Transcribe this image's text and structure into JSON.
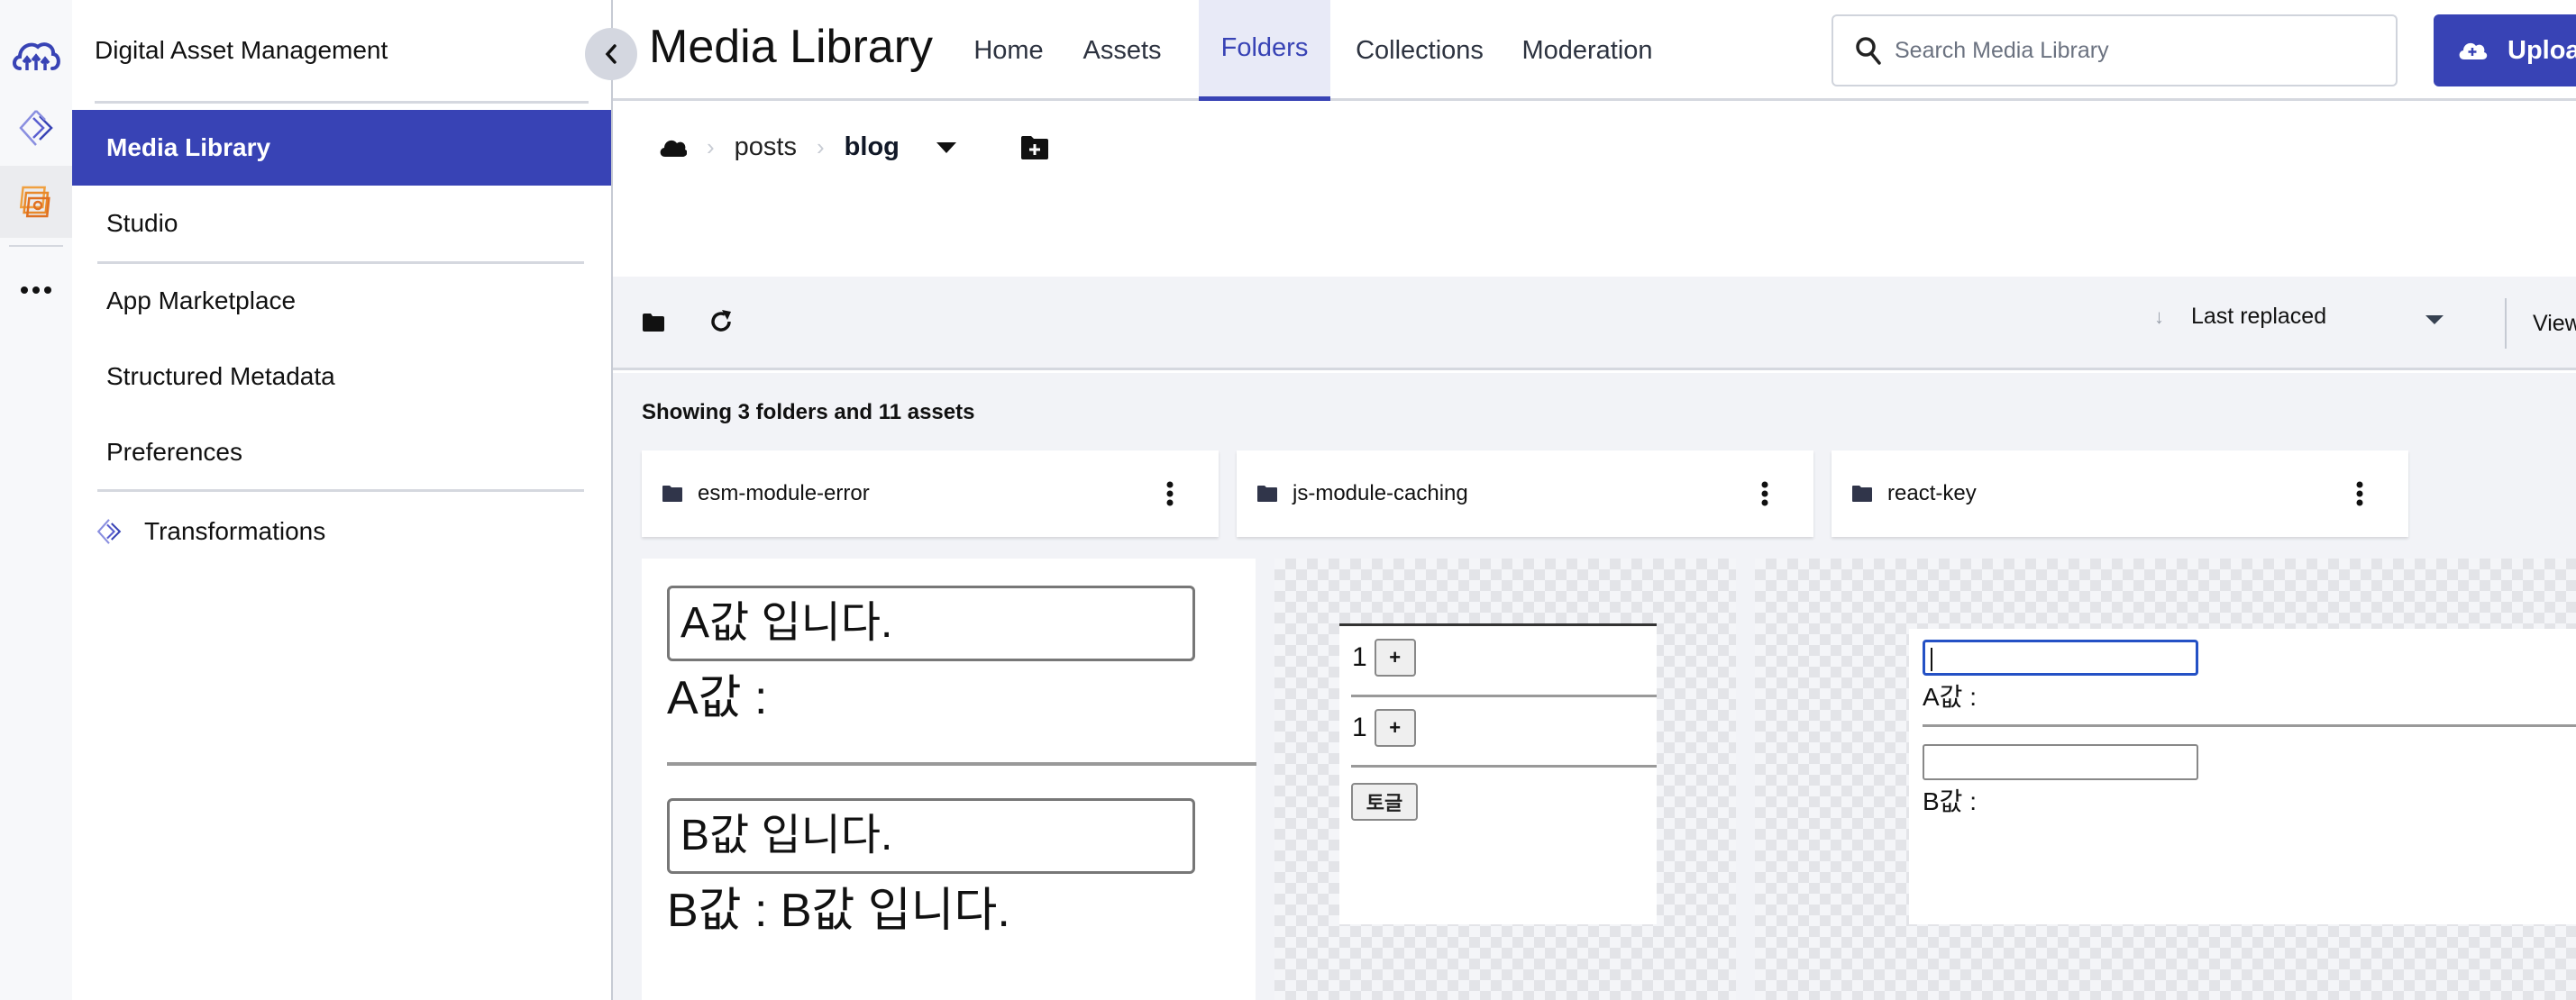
{
  "app": {
    "section_title": "Digital Asset Management",
    "page_title": "Media Library"
  },
  "rail": {
    "items": [
      {
        "icon": "cloudinary-logo-icon"
      },
      {
        "icon": "transformations-icon"
      },
      {
        "icon": "media-library-icon",
        "active": true
      },
      {
        "icon": "more-icon"
      }
    ]
  },
  "sidebar": {
    "collapse_label": "‹",
    "items": [
      {
        "label": "Media Library",
        "active": true
      },
      {
        "label": "Studio"
      },
      {
        "label": "App Marketplace"
      },
      {
        "label": "Structured Metadata"
      },
      {
        "label": "Preferences"
      },
      {
        "label": "Transformations"
      }
    ]
  },
  "nav": {
    "tabs": [
      {
        "label": "Home"
      },
      {
        "label": "Assets"
      },
      {
        "label": "Folders",
        "active": true
      },
      {
        "label": "Collections"
      },
      {
        "label": "Moderation"
      }
    ]
  },
  "search": {
    "placeholder": "Search Media Library",
    "value": ""
  },
  "upload": {
    "label": "Upload"
  },
  "breadcrumb": {
    "root_icon": "cloud-icon",
    "items": [
      "posts",
      "blog"
    ],
    "current": "blog"
  },
  "toolbar": {
    "sort_label": "Last replaced",
    "view_label": "View"
  },
  "content": {
    "count_label": "Showing 3 folders and 11 assets",
    "folders": [
      {
        "name": "esm-module-error"
      },
      {
        "name": "js-module-caching"
      },
      {
        "name": "react-key"
      }
    ],
    "thumbnails": [
      {
        "type": "screenshot",
        "input_a": "A값 입니다.",
        "label_a": "A값 :",
        "input_b": "B값 입니다.",
        "label_b": "B값 : B값 입니다."
      },
      {
        "type": "screenshot",
        "counter_1": "1",
        "counter_2": "1",
        "plus_label": "+",
        "toggle_label": "토글"
      },
      {
        "type": "screenshot",
        "label_a": "A값 :",
        "label_b": "B값 :"
      }
    ]
  },
  "colors": {
    "accent": "#3843b5",
    "active_tab_bg": "#e8eaf7",
    "content_bg": "#f2f3f7",
    "focus_blue": "#2451c5",
    "media_icon_orange": "#e8892b"
  }
}
